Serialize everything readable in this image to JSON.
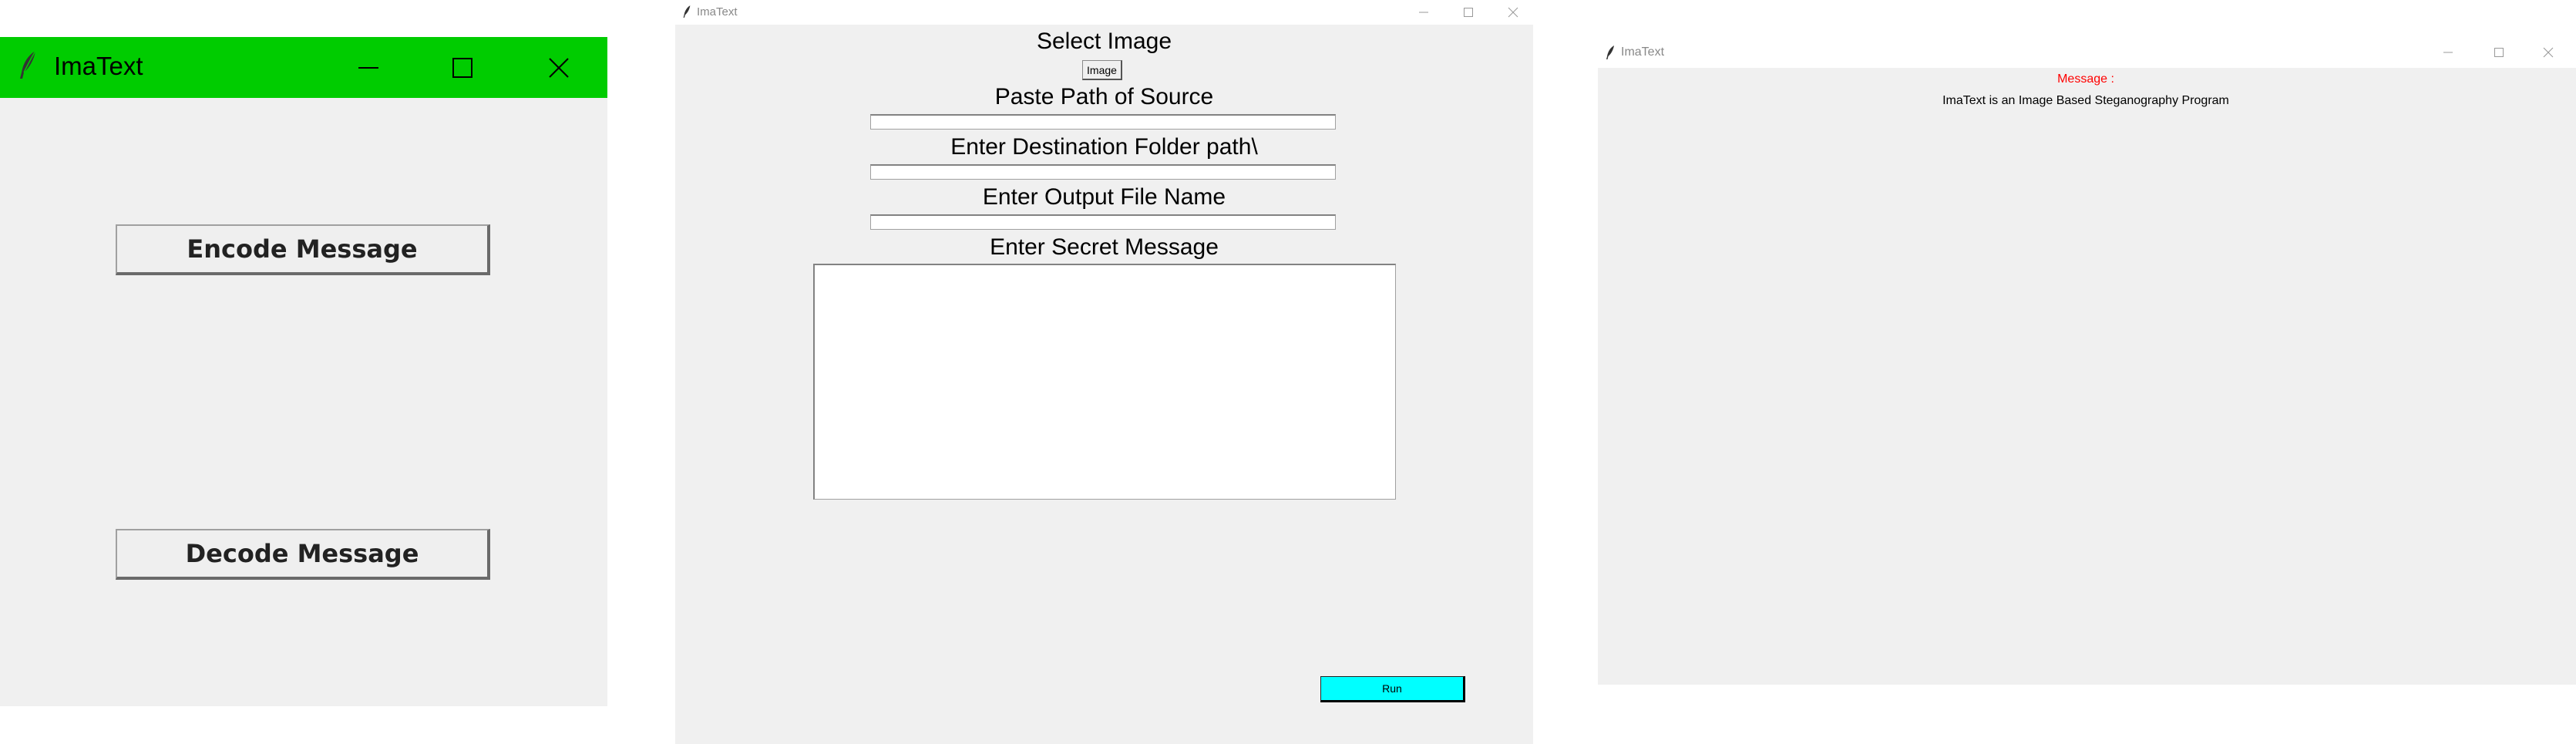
{
  "encode_window": {
    "title": "ImaText",
    "titlebar_color": "#00cc00",
    "icon": "feather-icon",
    "encode_button": "Encode Message",
    "decode_button": "Decode Message"
  },
  "encode_form_window": {
    "title": "ImaText",
    "select_image_label": "Select Image",
    "image_button": "Image",
    "source_path_label": "Paste Path of Source",
    "source_path_value": "",
    "destination_label": "Enter Destination Folder path\\",
    "destination_value": "",
    "output_name_label": "Enter Output File Name",
    "output_name_value": "",
    "secret_message_label": "Enter Secret Message",
    "secret_message_value": "",
    "run_button": "Run",
    "run_button_color": "#00ffff"
  },
  "message_window": {
    "title": "ImaText",
    "message_label": "Message :",
    "message_label_color": "#ff0000",
    "message_text": "ImaText is an Image Based Steganography Program"
  }
}
